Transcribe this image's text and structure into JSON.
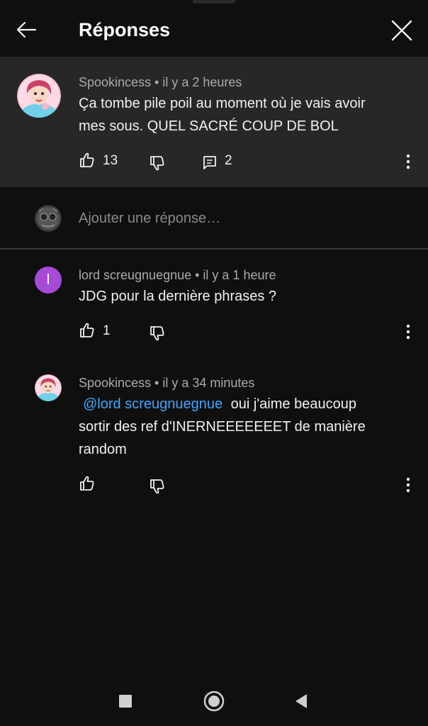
{
  "header": {
    "title": "Réponses",
    "back_icon": "arrow-left-icon",
    "close_icon": "close-icon"
  },
  "parent_comment": {
    "author": "Spookincess",
    "time": "il y a 2 heures",
    "meta": "Spookincess • il y a 2 heures",
    "text_line1": "Ça tombe pile poil au moment où je vais avoir",
    "text_line2": "mes sous. QUEL SACRÉ COUP DE BOL",
    "likes": "13",
    "replies": "2"
  },
  "reply_input": {
    "placeholder": "Ajouter une réponse…"
  },
  "replies": [
    {
      "author": "lord screugnuegnue",
      "meta": "lord screugnuegnue • il y a 1 heure",
      "avatar_letter": "l",
      "avatar_color": "#a64bd6",
      "text": "JDG pour la dernière phrases ?",
      "likes": "1"
    },
    {
      "author": "Spookincess",
      "meta": "Spookincess • il y a 34 minutes",
      "mention": "@lord screugnuegnue",
      "text_after_mention": "oui j'aime beaucoup",
      "text_line2": "sortir des ref d'INERNEEEEEEET de manière",
      "text_line3": "random",
      "likes": ""
    }
  ],
  "colors": {
    "background": "#0f0f0f",
    "parent_background": "#272727",
    "mention": "#3ea6ff",
    "meta_text": "#aaaaaa"
  },
  "navbar": {
    "recent_icon": "square-icon",
    "home_icon": "circle-icon",
    "back_icon": "triangle-back-icon"
  }
}
